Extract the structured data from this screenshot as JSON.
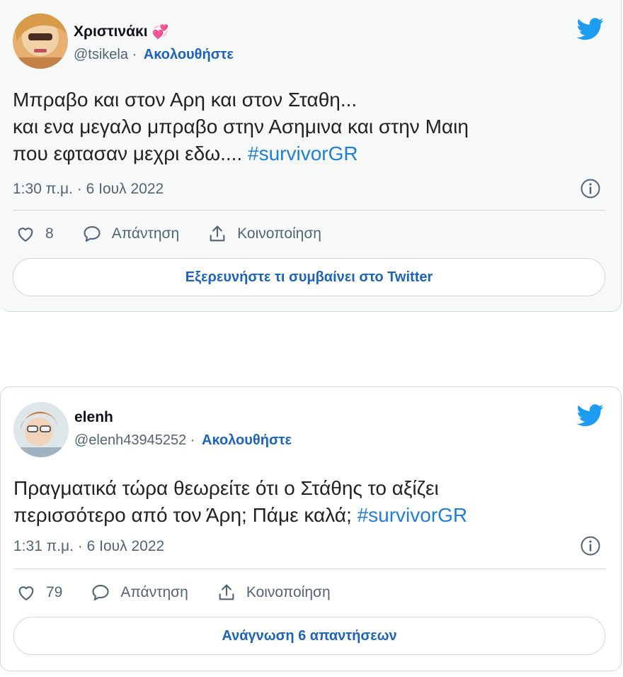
{
  "tweets": [
    {
      "display_name": "Χριστινάκι",
      "name_emoji": "💞",
      "handle": "@tsikela",
      "separator": "·",
      "follow_label": "Ακολουθήστε",
      "text_lines": [
        "Μπραβο και στον Αρη και στον Σταθη...",
        "και ενα μεγαλο μπραβο στην Ασημινα και στην  Μαιη",
        "που εφτασαν μεχρι εδω.... "
      ],
      "hashtag": "#survivorGR",
      "timestamp": "1:30 π.μ. · 6 Ιουλ 2022",
      "like_count": "8",
      "reply_label": "Απάντηση",
      "share_label": "Κοινοποίηση",
      "cta_label": "Εξερευνήστε τι συμβαίνει στο Twitter"
    },
    {
      "display_name": "elenh",
      "handle": "@elenh43945252",
      "separator": "·",
      "follow_label": "Ακολουθήστε",
      "text_lines": [
        "Πραγματικά τώρα θεωρείτε ότι ο Στάθης το αξίζει",
        "περισσότερο από τον Άρη; Πάμε καλά; "
      ],
      "hashtag": "#survivorGR",
      "timestamp": "1:31 π.μ. · 6 Ιουλ 2022",
      "like_count": "79",
      "reply_label": "Απάντηση",
      "share_label": "Κοινοποίηση",
      "cta_label": "Ανάγνωση 6 απαντήσεων"
    }
  ],
  "icons": {
    "brand": "twitter-bird-icon",
    "like": "heart-icon",
    "reply": "speech-bubble-icon",
    "share": "share-arrow-icon",
    "info": "info-icon"
  },
  "colors": {
    "twitter_blue": "#1d9bf0",
    "link_blue": "#1d64b8",
    "hashtag_blue": "#1d7fd8",
    "muted_text": "#536471",
    "border": "#cfd9de"
  }
}
